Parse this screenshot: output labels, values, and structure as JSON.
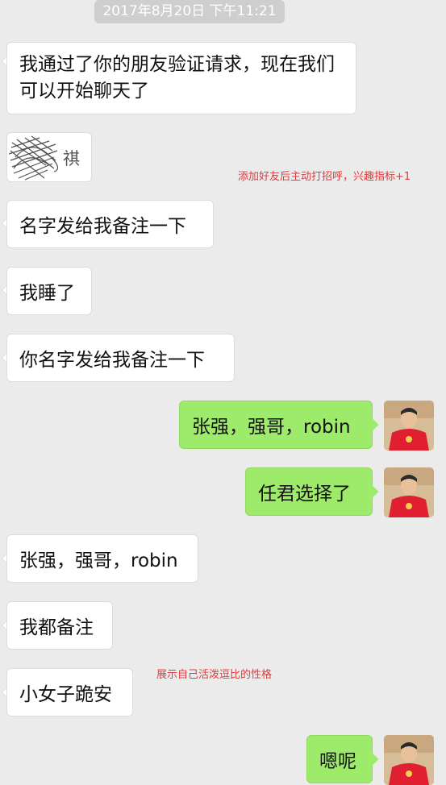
{
  "chat": {
    "timestamp": "2017年8月20日 下午11:21",
    "messages": [
      {
        "text": "我通过了你的朋友验证请求，现在我们可以开始聊天了"
      },
      {
        "text": "名字发给我备注一下"
      },
      {
        "text": "我睡了"
      },
      {
        "text": "你名字发给我备注一下"
      },
      {
        "text": "张强，强哥，robin"
      },
      {
        "text": "任君选择了"
      },
      {
        "text": "张强，强哥，robin"
      },
      {
        "text": "我都备注"
      },
      {
        "text": "小女子跪安"
      },
      {
        "text": "嗯呢"
      }
    ],
    "blurred_partial_text": "祺"
  },
  "annotations": {
    "note1": "添加好友后主动打招呼，兴趣指标+1",
    "note2": "展示自己活泼逗比的性格"
  },
  "colors": {
    "background": "#ebebeb",
    "incoming_bubble": "#ffffff",
    "outgoing_bubble": "#9eea6a",
    "annotation": "#e03a3a"
  }
}
